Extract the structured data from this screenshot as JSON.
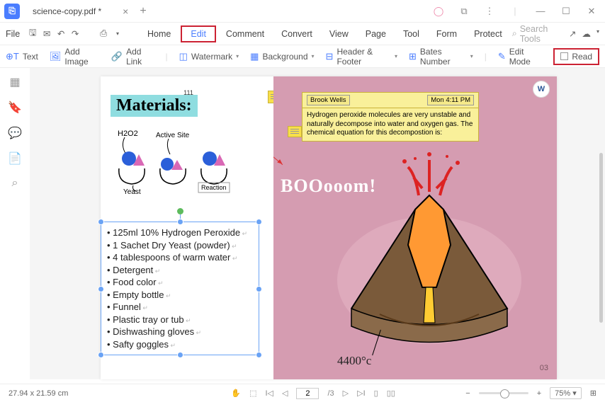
{
  "titlebar": {
    "filename": "science-copy.pdf *"
  },
  "menu": {
    "file": "File",
    "home": "Home",
    "edit": "Edit",
    "comment": "Comment",
    "convert": "Convert",
    "view": "View",
    "page": "Page",
    "tool": "Tool",
    "form": "Form",
    "protect": "Protect",
    "search": "Search Tools"
  },
  "toolbar": {
    "text": "Text",
    "add_image": "Add Image",
    "add_link": "Add Link",
    "watermark": "Watermark",
    "background": "Background",
    "header_footer": "Header & Footer",
    "bates": "Bates Number",
    "edit_mode": "Edit Mode",
    "read": "Read"
  },
  "doc": {
    "materials_num": "111",
    "materials_title": "Materials:",
    "h2o2": "H2O2",
    "active_site": "Active Site",
    "yeast": "Yeast",
    "reaction": "Reaction",
    "items": [
      "125ml 10% Hydrogen Peroxide",
      "1 Sachet Dry Yeast (powder)",
      "4 tablespoons of warm water",
      "Detergent",
      "Food color",
      "Empty bottle",
      "Funnel",
      "Plastic tray or tub",
      "Dishwashing gloves",
      "Safty goggles"
    ],
    "note_author": "Brook Wells",
    "note_time": "Mon 4:11 PM",
    "note_text": "Hydrogen peroxide molecules are very unstable and naturally decompose into water and oxygen gas. The chemical equation for this decompostion is:",
    "boom": "BOOooom!",
    "temp": "4400°c",
    "pgnum": "03"
  },
  "status": {
    "dims": "27.94 x 21.59 cm",
    "page": "2",
    "total": "/3",
    "zoom": "75%"
  }
}
